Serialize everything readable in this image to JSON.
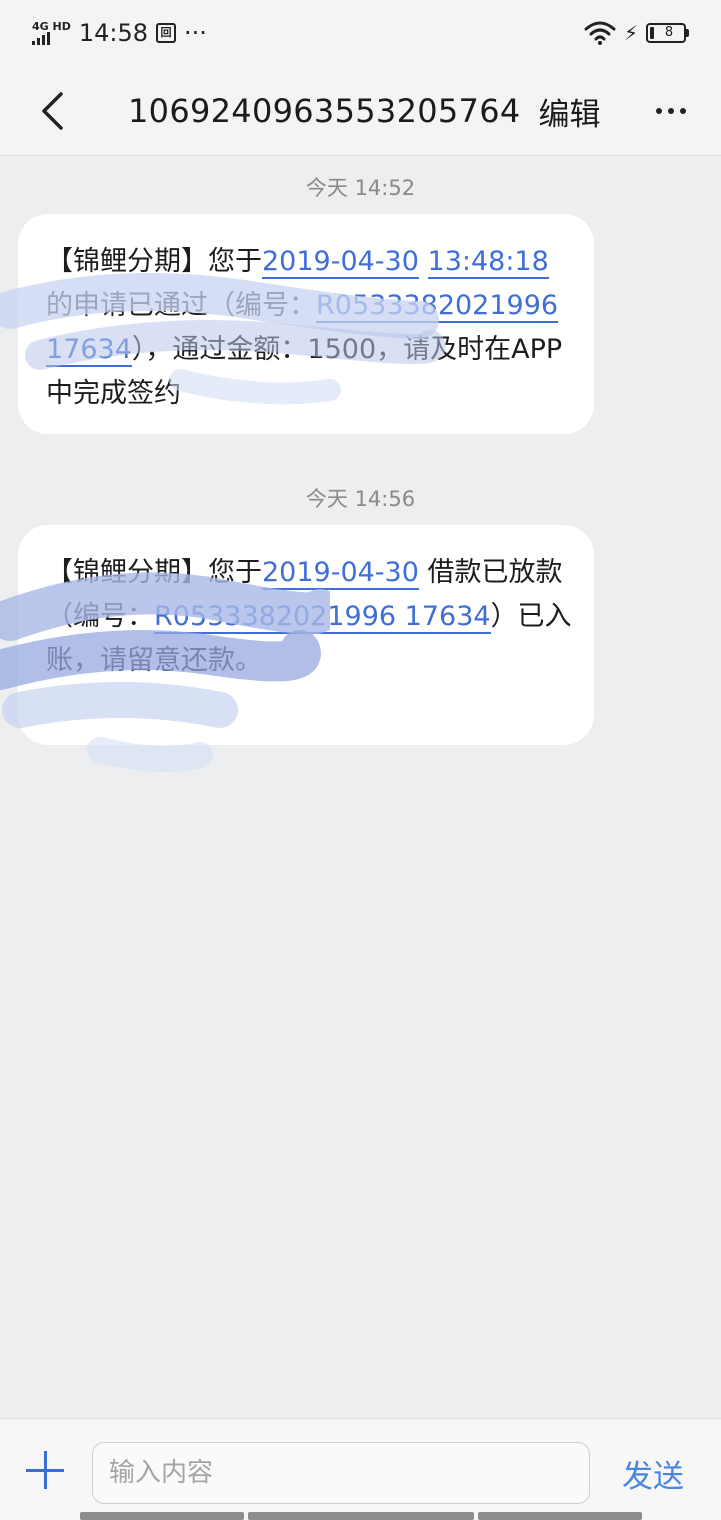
{
  "status_bar": {
    "network": "4G HD",
    "time": "14:58",
    "sim_label": "回",
    "overflow": "···",
    "battery": "8"
  },
  "header": {
    "title": "1069240963553205764",
    "edit_label": "编辑"
  },
  "messages": [
    {
      "timestamp": "今天 14:52",
      "segments": [
        {
          "text": "【锦鲤分期】您于",
          "link": false
        },
        {
          "text": "2019-04-30",
          "link": true
        },
        {
          "text": " ",
          "link": false
        },
        {
          "text": "13:48:18",
          "link": true
        },
        {
          "text": "的申请已通过（编号：",
          "link": false
        },
        {
          "text": "R0533382021996 17634",
          "link": true
        },
        {
          "text": "），通过金额：1500，请及时在APP中完成签约",
          "link": false
        }
      ]
    },
    {
      "timestamp": "今天 14:56",
      "segments": [
        {
          "text": "【锦鲤分期】您于",
          "link": false
        },
        {
          "text": "2019-04-30",
          "link": true
        },
        {
          "text": " 借款已放款（编号：",
          "link": false
        },
        {
          "text": "R0533382021996 17634",
          "link": true
        },
        {
          "text": "）已入账，请留意还款。",
          "link": false
        }
      ]
    }
  ],
  "input_bar": {
    "placeholder": "输入内容",
    "send_label": "发送"
  },
  "colors": {
    "link": "#3f6fd6",
    "accent": "#3a6fd8",
    "background": "#eceeef"
  }
}
